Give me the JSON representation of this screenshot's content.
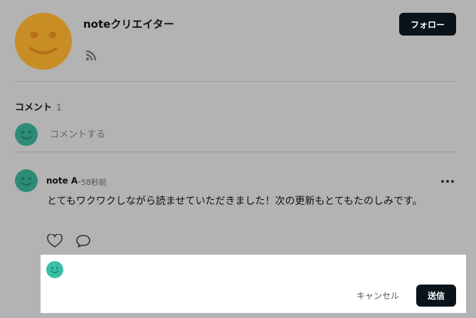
{
  "creator": {
    "name": "noteクリエイター",
    "avatar_icon": "smiley-face-icon",
    "avatar_color": "#c98d26",
    "rss_icon": "rss-icon",
    "follow_label": "フォロー"
  },
  "comments": {
    "title": "コメント",
    "count": "1",
    "input_placeholder": "コメントする",
    "items": [
      {
        "author": "note A",
        "separator": "・",
        "time": "58秒前",
        "body": "とてもワクワクしながら読ませていただきました！次の更新もとてもたのしみです。",
        "avatar_color": "#2d8b78",
        "like_icon": "heart-icon",
        "reply_icon": "speech-bubble-icon",
        "more_icon": "more-dots-icon"
      }
    ]
  },
  "reply": {
    "value": "",
    "avatar_color": "#3dbea6",
    "cancel_label": "キャンセル",
    "send_label": "送信"
  },
  "colors": {
    "overlay_background": "#b3b3b3",
    "primary_button": "#08131a"
  }
}
